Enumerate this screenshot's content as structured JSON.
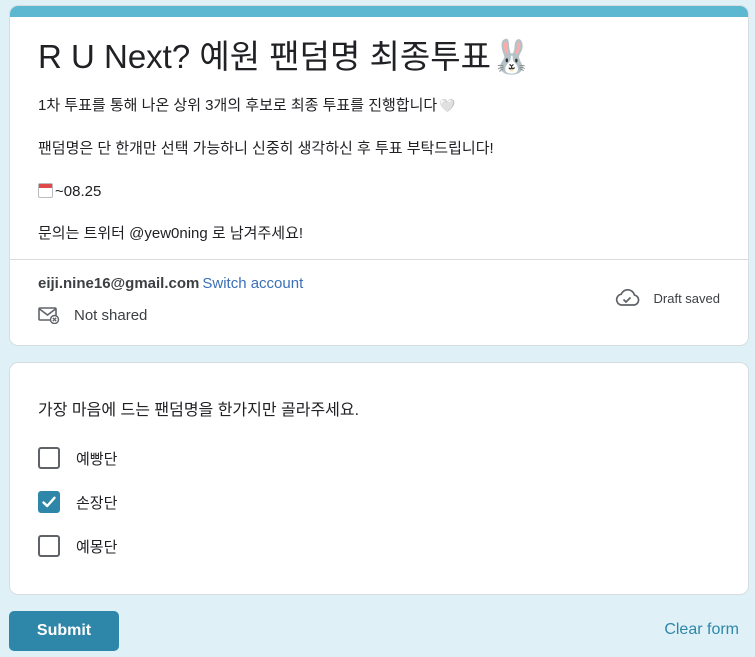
{
  "form": {
    "title": "R U Next? 예원 팬덤명 최종투표",
    "title_emoji": "🐰",
    "accent_color": "#5cb8d0",
    "description": {
      "line1": "1차 투표를 통해 나온 상위 3개의 후보로 최종 투표를 진행합니다",
      "line1_emoji": "🤍",
      "line2": "팬덤명은 단 한개만 선택 가능하니 신중히 생각하신 후 투표 부탁드립니다!",
      "line3_date": "~08.25",
      "line4": "문의는 트위터 @yew0ning 로 남겨주세요!"
    }
  },
  "account": {
    "email": "eiji.nine16@gmail.com",
    "switch_label": "Switch account",
    "not_shared_label": "Not shared",
    "draft_status": "Draft saved"
  },
  "question": {
    "title": "가장 마음에 드는 팬덤명을 한가지만 골라주세요.",
    "options": [
      {
        "label": "예빵단",
        "checked": false
      },
      {
        "label": "손장단",
        "checked": true
      },
      {
        "label": "예몽단",
        "checked": false
      }
    ]
  },
  "footer": {
    "submit_label": "Submit",
    "clear_label": "Clear form"
  },
  "colors": {
    "primary": "#2e87a8",
    "link": "#3b6fb6",
    "background": "#dff1f7"
  },
  "icons": {
    "calendar": "calendar-icon",
    "mail_off": "mail-not-shared-icon",
    "cloud": "cloud-check-icon",
    "checkmark": "checkmark-icon"
  }
}
